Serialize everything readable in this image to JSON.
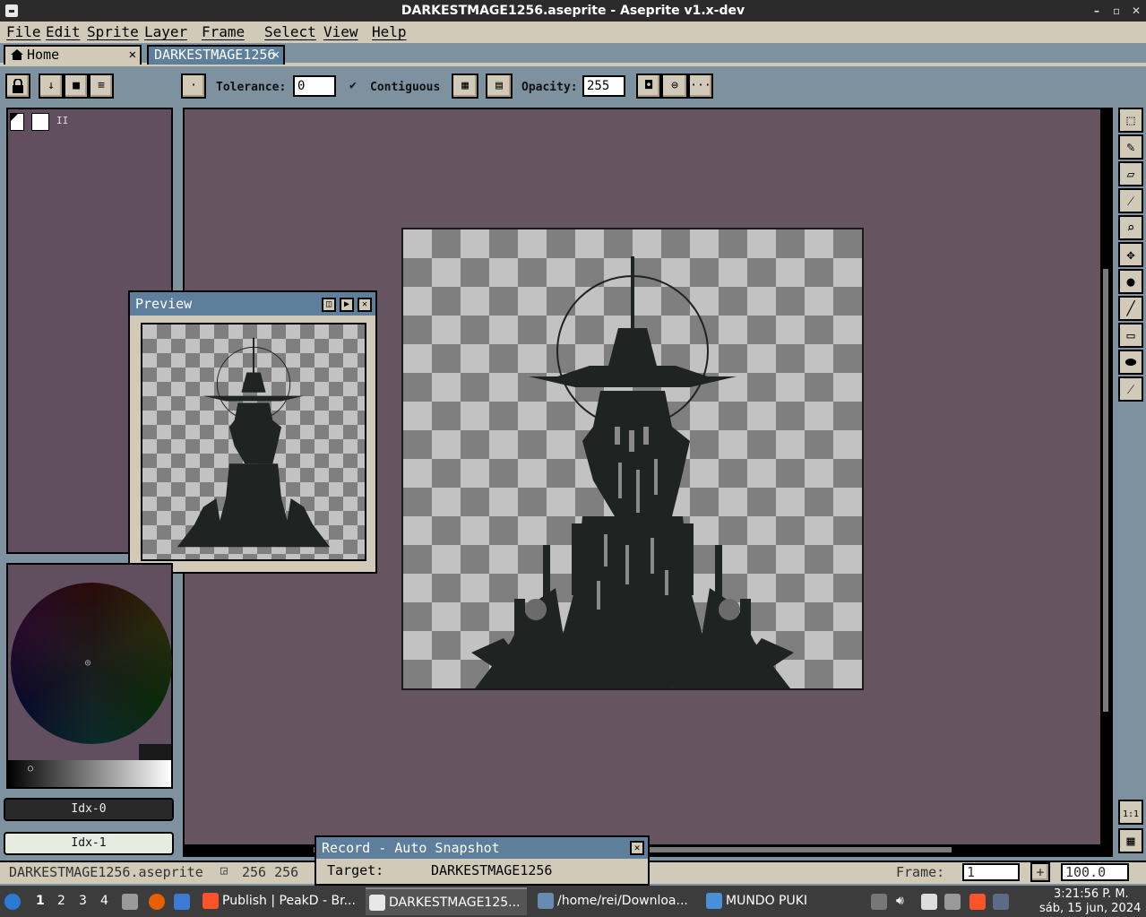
{
  "window": {
    "title": "DARKESTMAGE1256.aseprite - Aseprite v1.x-dev"
  },
  "menu": [
    "File",
    "Edit",
    "Sprite",
    "Layer",
    "Frame",
    "Select",
    "View",
    "Help"
  ],
  "tabs": {
    "home": "Home",
    "doc": "DARKESTMAGE1256"
  },
  "context": {
    "tolerance_label": "Tolerance:",
    "tolerance_value": "0",
    "contiguous_label": "Contiguous",
    "opacity_label": "Opacity:",
    "opacity_value": "255"
  },
  "layers": {
    "layer_marker": "II"
  },
  "preview": {
    "title": "Preview"
  },
  "palette": {
    "fg": "Idx-0",
    "bg": "Idx-1"
  },
  "status": {
    "filename": "DARKESTMAGE1256.aseprite",
    "size": "256 256",
    "frame_label": "Frame:",
    "frame_value": "1",
    "zoom": "100.0"
  },
  "record": {
    "title": "Record - Auto Snapshot",
    "target_label": "Target:",
    "target_value": "DARKESTMAGE1256"
  },
  "taskbar": {
    "workspaces": [
      "1",
      "2",
      "3",
      "4"
    ],
    "items": [
      "Publish | PeakD - Br...",
      "DARKESTMAGE125...",
      "/home/rei/Downloa...",
      "MUNDO PUKI"
    ],
    "time": "3:21:56 P. M.",
    "date": "sáb, 15 jun, 2024"
  },
  "colors": {
    "accent": "#5d7f9c",
    "panel": "#d2cab8",
    "canvas_bg": "#665461",
    "ink": "#1f2321"
  }
}
